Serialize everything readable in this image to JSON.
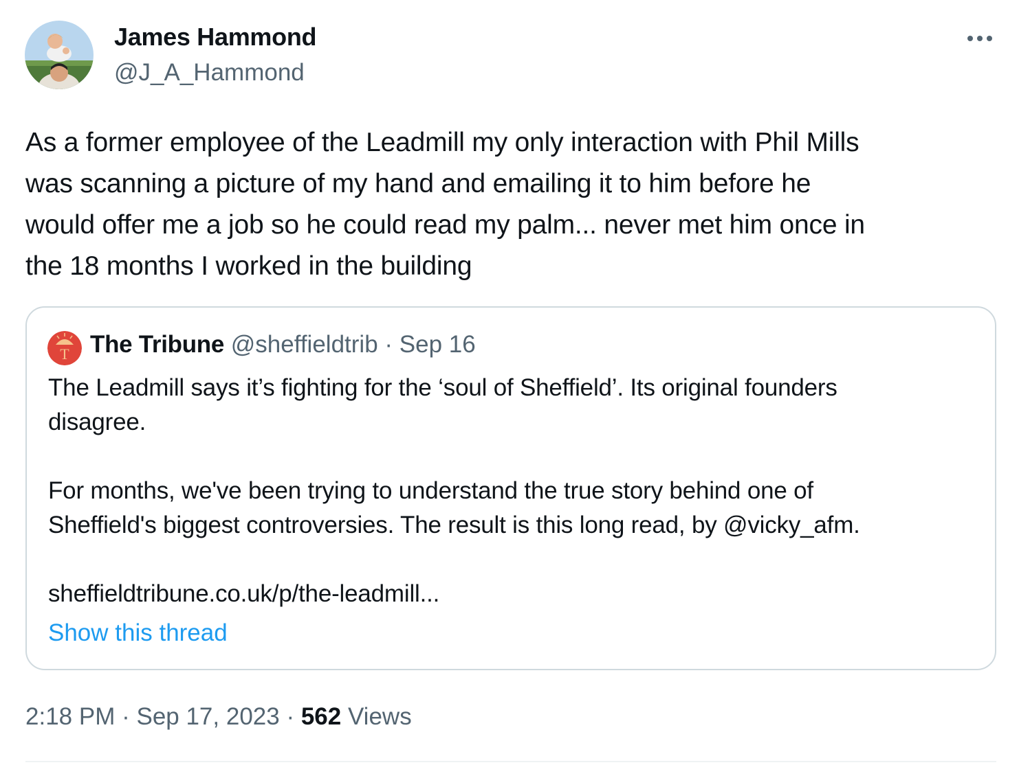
{
  "author": {
    "name": "James Hammond",
    "handle": "@J_A_Hammond",
    "avatar_icon": "profile-photo-avatar"
  },
  "more_icon": "more-horizontal-icon",
  "tweet_text": "As a former employee of the Leadmill my only interaction with Phil Mills\nwas scanning a picture of my hand and emailing it to him before he\nwould offer me a job so he could read my palm... never met him once in\nthe 18 months I worked in the building",
  "quote": {
    "avatar_icon": "tribune-logo-avatar",
    "name": "The Tribune",
    "handle": "@sheffieldtrib",
    "separator": " · ",
    "date": "Sep 16",
    "text": "The Leadmill says it’s fighting for the ‘soul of Sheffield’. Its original founders\ndisagree.\n\nFor months, we've been trying to understand the true story behind one of\nSheffield's biggest controversies. The result is this long read, by @vicky_afm.\n\nsheffieldtribune.co.uk/p/the-leadmill...",
    "show_thread": "Show this thread"
  },
  "meta": {
    "time": "2:18 PM",
    "sep1": " · ",
    "date": "Sep 17, 2023",
    "sep2": " · ",
    "views_count": "562",
    "views_label": " Views"
  },
  "colors": {
    "text": "#0f1419",
    "secondary": "#536471",
    "link": "#1d9bf0",
    "border": "#cfd9de",
    "tribune_red": "#e0453a"
  }
}
